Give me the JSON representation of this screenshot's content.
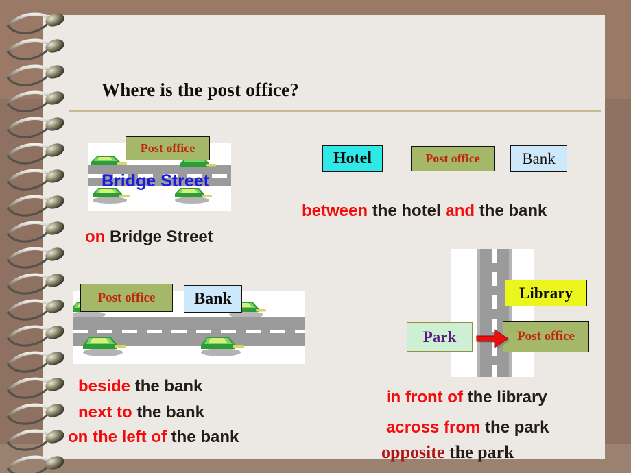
{
  "slide": {
    "title": "Where is the post office?",
    "background_color": "#8e7160",
    "page_color": "#ece8e4",
    "rule_color": "#c8b98e"
  },
  "colors": {
    "red_highlight": "#f40b0b",
    "dark_text": "#231c16",
    "post_office_fill": "#a5b86a",
    "post_office_text": "#c0260b",
    "hotel_fill": "#2fe9e9",
    "bank_fill": "#cde8fb",
    "library_fill": "#ecf51c",
    "park_fill": "#cdf0d4",
    "park_text": "#5b1b7a",
    "street_label_text": "#1a1ae0",
    "arrow_color": "#ec0d0d",
    "road_color": "#9b9b9b"
  },
  "diagram_bridge_street": {
    "post_office_label": "Post office",
    "street_label": "Bridge Street",
    "caption": {
      "highlight": "on",
      "rest": "Bridge Street"
    }
  },
  "diagram_between": {
    "hotel_label": "Hotel",
    "post_office_label": "Post office",
    "bank_label": "Bank",
    "caption": {
      "highlight_1": "between",
      "mid": "the hotel",
      "highlight_2": "and",
      "rest": "the bank"
    }
  },
  "diagram_beside": {
    "post_office_label": "Post office",
    "bank_label": "Bank",
    "captions": [
      {
        "highlight": "beside",
        "rest": "the bank"
      },
      {
        "highlight": "next to",
        "rest": "the bank"
      },
      {
        "highlight": "on the left of",
        "rest": "the bank"
      }
    ]
  },
  "diagram_across": {
    "library_label": "Library",
    "park_label": "Park",
    "post_office_label": "Post office",
    "arrow_name": "right-arrow-icon",
    "captions": [
      {
        "highlight": "in front of",
        "rest": "the library",
        "style": "sans"
      },
      {
        "highlight": "across from",
        "rest": "the park",
        "style": "sans"
      },
      {
        "highlight": "opposite",
        "rest": "the park",
        "style": "serif"
      }
    ]
  }
}
